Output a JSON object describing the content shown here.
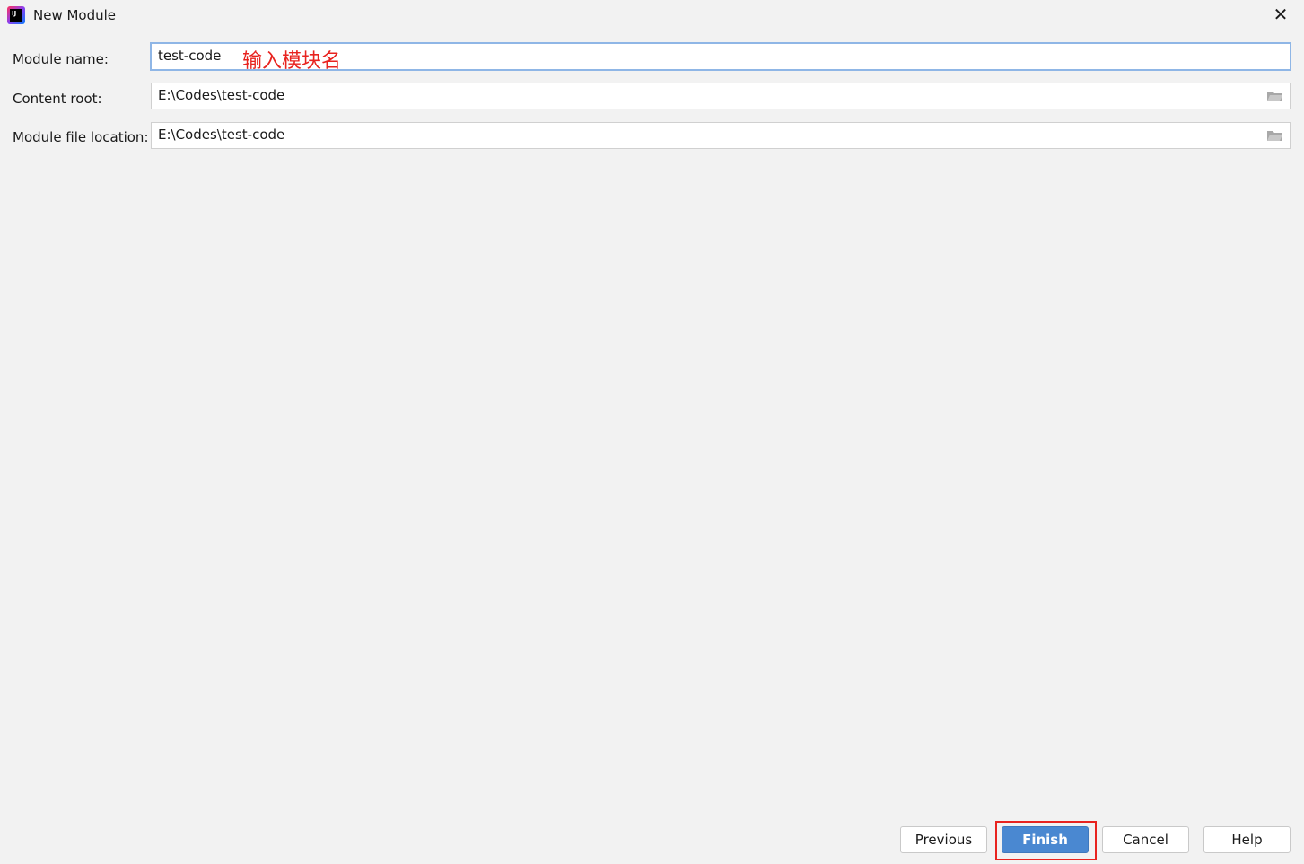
{
  "window": {
    "title": "New Module",
    "logo_text": "IJ",
    "icon": "intellij-logo"
  },
  "form": {
    "module_name": {
      "label": "Module name:",
      "value": "test-code",
      "annotation": "输入模块名"
    },
    "content_root": {
      "label": "Content root:",
      "value": "E:\\Codes\\test-code"
    },
    "module_file_location": {
      "label": "Module file location:",
      "value": "E:\\Codes\\test-code"
    }
  },
  "buttons": {
    "previous": "Previous",
    "finish": "Finish",
    "cancel": "Cancel",
    "help": "Help"
  },
  "colors": {
    "primary": "#4a88d1",
    "annotation": "#e8231f",
    "focus": "#8fb6e6"
  }
}
